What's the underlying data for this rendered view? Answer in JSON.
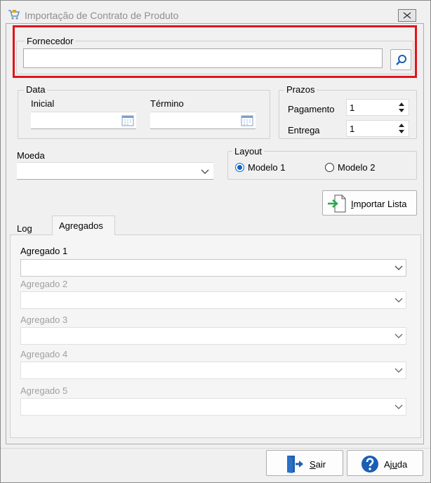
{
  "window": {
    "title": "Importação de Contrato de Produto"
  },
  "fornecedor": {
    "legend": "Fornecedor",
    "value": ""
  },
  "data": {
    "legend": "Data",
    "inicial_label": "Inicial",
    "termino_label": "Término",
    "inicial_value": "",
    "termino_value": ""
  },
  "prazos": {
    "legend": "Prazos",
    "pagamento_label": "Pagamento",
    "pagamento_value": "1",
    "entrega_label": "Entrega",
    "entrega_value": "1"
  },
  "moeda": {
    "label": "Moeda",
    "value": ""
  },
  "layout": {
    "legend": "Layout",
    "option1": "Modelo 1",
    "option2": "Modelo 2",
    "selected": "Modelo 1"
  },
  "importar": {
    "label_pre": "I",
    "label_rest": "mportar Lista"
  },
  "tabs": [
    {
      "label": "Log"
    },
    {
      "label": "Agregados"
    }
  ],
  "active_tab": "Agregados",
  "agregados": [
    {
      "label": "Agregado 1",
      "value": "",
      "enabled": true
    },
    {
      "label": "Agregado 2",
      "value": "",
      "enabled": false
    },
    {
      "label": "Agregado 3",
      "value": "",
      "enabled": false
    },
    {
      "label": "Agregado 4",
      "value": "",
      "enabled": false
    },
    {
      "label": "Agregado 5",
      "value": "",
      "enabled": false
    }
  ],
  "footer": {
    "sair_pre": "S",
    "sair_rest": "air",
    "ajuda_pre": "Aj",
    "ajuda_u": "u",
    "ajuda_rest": "da"
  },
  "colors": {
    "highlight": "#e1131c",
    "accent": "#0a64c8"
  }
}
